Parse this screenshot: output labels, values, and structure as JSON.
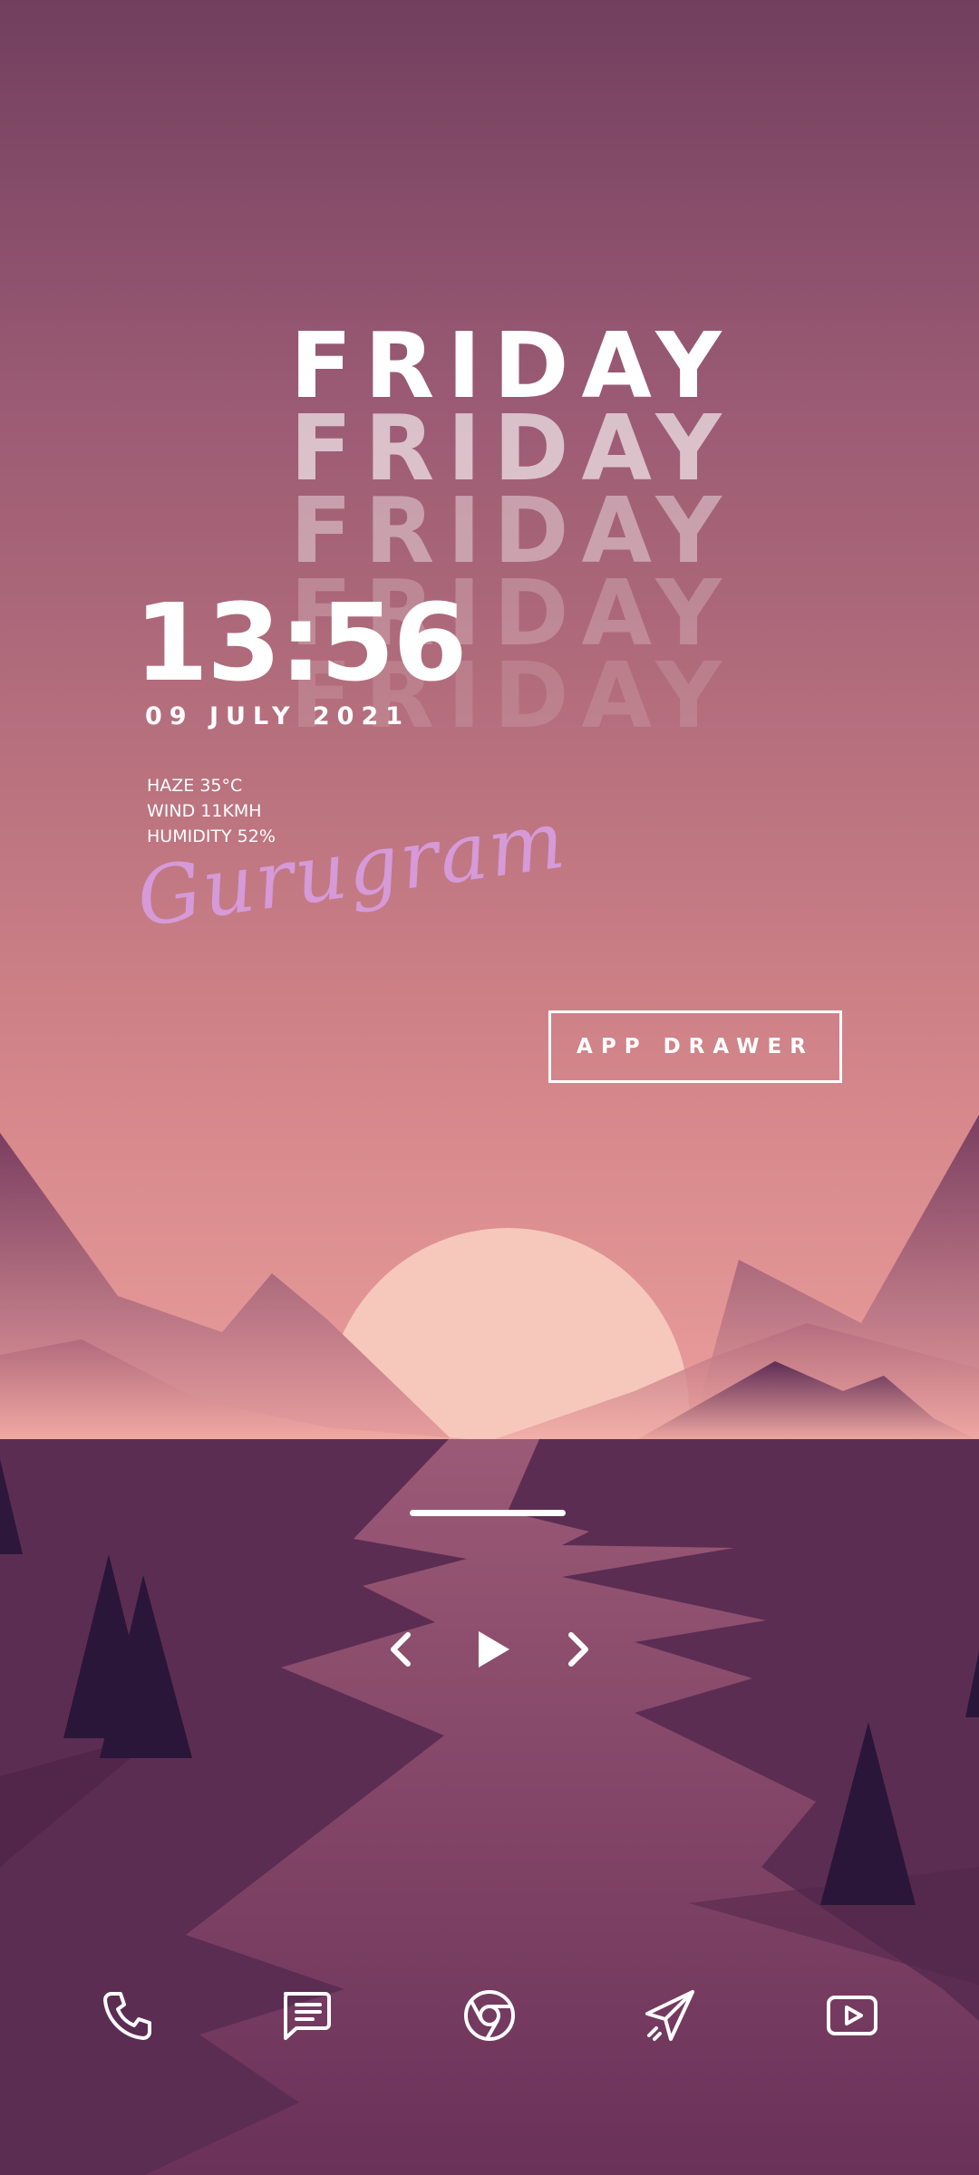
{
  "widget": {
    "day_lines": [
      "FRIDAY",
      "FRIDAY",
      "FRIDAY",
      "FRIDAY",
      "FRIDAY"
    ],
    "time": "13:56",
    "date": "09 JULY 2021",
    "weather": {
      "condition": "HAZE 35°C",
      "wind": "WIND 11KMH",
      "humidity": "HUMIDITY 52%"
    },
    "city": "Gurugram"
  },
  "app_drawer_label": "APP DRAWER",
  "media_controls": {
    "previous_icon": "chevron-left-icon",
    "play_icon": "play-icon",
    "next_icon": "chevron-right-icon"
  },
  "dock": {
    "items": [
      {
        "icon": "phone-icon"
      },
      {
        "icon": "message-icon"
      },
      {
        "icon": "chrome-icon"
      },
      {
        "icon": "send-icon"
      },
      {
        "icon": "youtube-icon"
      }
    ]
  },
  "colors": {
    "text": "#ffffff",
    "city_script": "#d59ad7",
    "valley": "#5c2d53",
    "sun": "#f6c8bb"
  }
}
